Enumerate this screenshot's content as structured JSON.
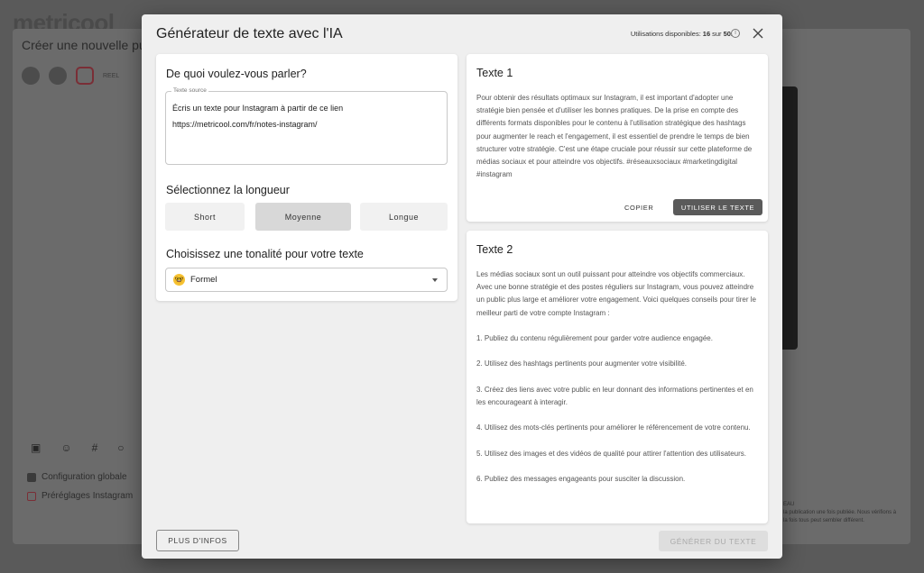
{
  "background": {
    "logo": "metricool",
    "title": "Créer une nouvelle publication",
    "reel_label": "REEL",
    "config_items": [
      "Configuration globale",
      "Préréglages Instagram"
    ],
    "right_label": "EAU",
    "right_note": "la publication une fois publiée. Nous vérifions à la fois tous peut sembler différent."
  },
  "modal": {
    "title": "Générateur de texte avec l'IA",
    "usage_label": "Utilisations disponibles:",
    "usage_used": "16",
    "usage_sep": "sur",
    "usage_total": "50."
  },
  "form": {
    "topic_title": "De quoi voulez-vous parler?",
    "source_label": "Texte source",
    "source_value": "Écris un texte pour Instagram à partir de ce lien\nhttps://metricool.com/fr/notes-instagram/",
    "length_title": "Sélectionnez la longueur",
    "length_options": [
      "Short",
      "Moyenne",
      "Longue"
    ],
    "length_selected": "Moyenne",
    "tone_title": "Choisissez une tonalité pour votre texte",
    "tone_value": "Formel",
    "tone_icon": "nerd-emoji-icon"
  },
  "results": [
    {
      "title": "Texte 1",
      "body": "Pour obtenir des résultats optimaux sur Instagram, il est important d'adopter une stratégie bien pensée et d'utiliser les bonnes pratiques. De la prise en compte des différents formats disponibles pour le contenu à l'utilisation stratégique des hashtags pour augmenter le reach et l'engagement, il est essentiel de prendre le temps de bien structurer votre stratégie. C'est une étape cruciale pour réussir sur cette plateforme de médias sociaux et pour atteindre vos objectifs. #réseauxsociaux #marketingdigital #instagram",
      "copy_label": "COPIER",
      "use_label": "UTILISER LE TEXTE"
    },
    {
      "title": "Texte 2",
      "paragraphs": [
        "Les médias sociaux sont un outil puissant pour atteindre vos objectifs commerciaux. Avec une bonne stratégie et des postes réguliers sur Instagram, vous pouvez atteindre un public plus large et améliorer votre engagement. Voici quelques conseils pour tirer le meilleur parti de votre compte Instagram :",
        "1. Publiez du contenu régulièrement pour garder votre audience engagée.",
        "2. Utilisez des hashtags pertinents pour augmenter votre visibilité.",
        "3. Créez des liens avec votre public en leur donnant des informations pertinentes et en les encourageant à interagir.",
        "4. Utilisez des mots-clés pertinents pour améliorer le référencement de votre contenu.",
        "5. Utilisez des images et des vidéos de qualité pour attirer l'attention des utilisateurs.",
        "6. Publiez des messages engageants pour susciter la discussion."
      ]
    }
  ],
  "footer": {
    "more_info_label": "PLUS D'INFOS",
    "generate_label": "GÉNÉRER DU TEXTE"
  },
  "colors": {
    "accent": "#5a5a5a",
    "modal_bg": "#efefef",
    "card_bg": "#ffffff",
    "disabled": "#dedede"
  }
}
